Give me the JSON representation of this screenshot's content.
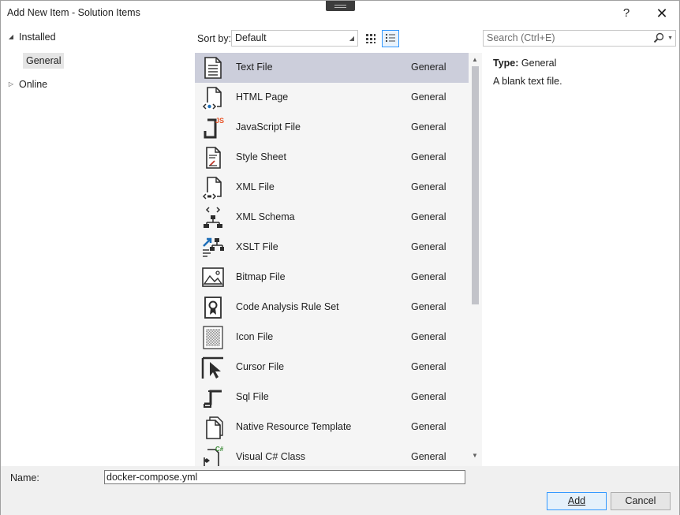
{
  "window": {
    "title": "Add New Item - Solution Items",
    "help_label": "?",
    "close_label": "✕"
  },
  "tree": {
    "installed": "Installed",
    "general": "General",
    "online": "Online"
  },
  "toolbar": {
    "sort_label": "Sort by:",
    "sort_value": "Default",
    "search_placeholder": "Search (Ctrl+E)"
  },
  "items": [
    {
      "name": "Text File",
      "category": "General",
      "icon": "text-file-icon"
    },
    {
      "name": "HTML Page",
      "category": "General",
      "icon": "html-page-icon"
    },
    {
      "name": "JavaScript File",
      "category": "General",
      "icon": "javascript-file-icon"
    },
    {
      "name": "Style Sheet",
      "category": "General",
      "icon": "style-sheet-icon"
    },
    {
      "name": "XML File",
      "category": "General",
      "icon": "xml-file-icon"
    },
    {
      "name": "XML Schema",
      "category": "General",
      "icon": "xml-schema-icon"
    },
    {
      "name": "XSLT File",
      "category": "General",
      "icon": "xslt-file-icon"
    },
    {
      "name": "Bitmap File",
      "category": "General",
      "icon": "bitmap-file-icon"
    },
    {
      "name": "Code Analysis Rule Set",
      "category": "General",
      "icon": "rule-set-icon"
    },
    {
      "name": "Icon File",
      "category": "General",
      "icon": "icon-file-icon"
    },
    {
      "name": "Cursor File",
      "category": "General",
      "icon": "cursor-file-icon"
    },
    {
      "name": "Sql File",
      "category": "General",
      "icon": "sql-file-icon"
    },
    {
      "name": "Native Resource Template",
      "category": "General",
      "icon": "resource-template-icon"
    },
    {
      "name": "Visual C# Class",
      "category": "General",
      "icon": "csharp-class-icon"
    }
  ],
  "details": {
    "type_label": "Type:",
    "type_value": "General",
    "description": "A blank text file."
  },
  "bottom": {
    "name_label": "Name:",
    "name_value": "docker-compose.yml",
    "add_label": "Add",
    "cancel_label": "Cancel"
  },
  "colors": {
    "selection": "#cccedb",
    "accent": "#3399ff",
    "js_badge": "#e8562a",
    "csharp_badge": "#388a34",
    "xslt_blue": "#1e6fb8"
  }
}
